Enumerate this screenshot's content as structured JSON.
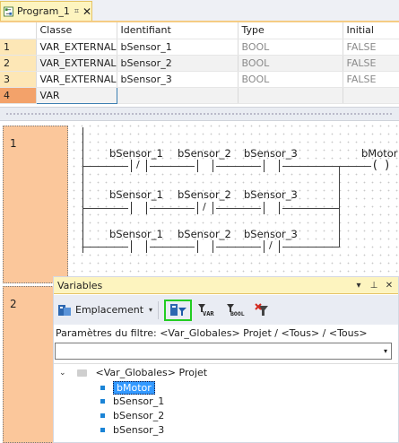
{
  "tab": {
    "title": "Program_1",
    "pin": "⌗",
    "close": "✕"
  },
  "table": {
    "headers": [
      "",
      "Classe",
      "Identifiant",
      "Type",
      "Initial"
    ],
    "rows": [
      {
        "num": "1",
        "classe": "VAR_EXTERNAL",
        "ident": "bSensor_1",
        "type": "BOOL",
        "initial": "FALSE"
      },
      {
        "num": "2",
        "classe": "VAR_EXTERNAL",
        "ident": "bSensor_2",
        "type": "BOOL",
        "initial": "FALSE"
      },
      {
        "num": "3",
        "classe": "VAR_EXTERNAL",
        "ident": "bSensor_3",
        "type": "BOOL",
        "initial": "FALSE"
      },
      {
        "num": "4",
        "classe": "VAR",
        "ident": "",
        "type": "",
        "initial": ""
      }
    ]
  },
  "ladder": {
    "networks": [
      {
        "num": "1"
      },
      {
        "num": "2"
      }
    ],
    "rung1": {
      "c1": "bSensor_1",
      "c1_mod": "/",
      "c2": "bSensor_2",
      "c3": "bSensor_3",
      "coil": "bMotor",
      "coil_sym": "( )"
    },
    "rung2": {
      "c1": "bSensor_1",
      "c2": "bSensor_2",
      "c2_mod": "/",
      "c3": "bSensor_3"
    },
    "rung3": {
      "c1": "bSensor_1",
      "c2": "bSensor_2",
      "c3": "bSensor_3",
      "c3_mod": "/"
    }
  },
  "variables_panel": {
    "title": "Variables",
    "btn_dropdown": "▾",
    "btn_pin": "⊥",
    "btn_close": "✕",
    "emplacement_label": "Emplacement",
    "dd_arrow": "▾",
    "icon_var": "VAR",
    "icon_bool": "BOOL",
    "filter_text": "Paramètres du filtre: <Var_Globales> Projet / <Tous> / <Tous>",
    "combo_arrow": "▾",
    "tree_toggle": "⌄",
    "tree_root": "<Var_Globales> Projet",
    "tree_items": [
      "bMotor",
      "bSensor_1",
      "bSensor_2",
      "bSensor_3"
    ]
  },
  "colors": {
    "accent_tab": "#fdf4bf",
    "network_bg": "#fbc79b",
    "selection": "#3399ff",
    "highlight_box": "#22cc22"
  }
}
